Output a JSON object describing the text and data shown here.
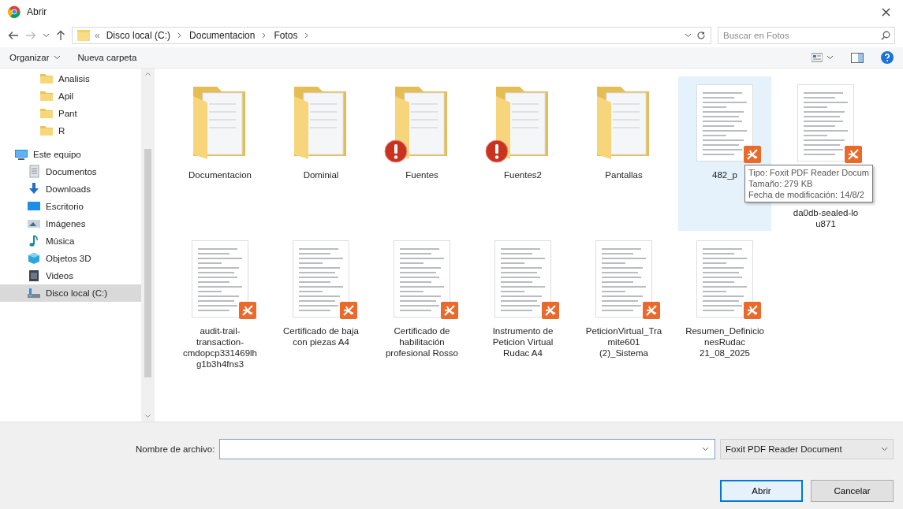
{
  "window": {
    "title": "Abrir"
  },
  "address_bar": {
    "overflow": "«",
    "path": [
      {
        "label": "Disco local (C:)"
      },
      {
        "label": "Documentacion"
      },
      {
        "label": "Fotos"
      }
    ],
    "search": {
      "placeholder": "Buscar en Fotos"
    }
  },
  "toolbar": {
    "organize": "Organizar",
    "new_folder": "Nueva carpeta"
  },
  "sidebar": {
    "items": [
      {
        "label": "Analisis",
        "kind": "folder",
        "selected": false
      },
      {
        "label": "Apil",
        "kind": "folder",
        "selected": false
      },
      {
        "label": "Pant",
        "kind": "folder",
        "selected": false
      },
      {
        "label": "R",
        "kind": "folder",
        "selected": false
      },
      {
        "label": "Este equipo",
        "kind": "pc",
        "selected": false,
        "children": [
          {
            "label": "Documentos",
            "kind": "documents",
            "selected": false
          },
          {
            "label": "Downloads",
            "kind": "downloads",
            "selected": false
          },
          {
            "label": "Escritorio",
            "kind": "desktop",
            "selected": false
          },
          {
            "label": "Imágenes",
            "kind": "pictures",
            "selected": false
          },
          {
            "label": "Música",
            "kind": "music",
            "selected": false
          },
          {
            "label": "Objetos 3D",
            "kind": "objects3d",
            "selected": false
          },
          {
            "label": "Videos",
            "kind": "videos",
            "selected": false
          },
          {
            "label": "Disco local (C:)",
            "kind": "drive",
            "selected": true
          }
        ]
      }
    ]
  },
  "files": [
    {
      "name": "Documentacion",
      "kind": "folder",
      "warning": false,
      "selected": false
    },
    {
      "name": "Dominial",
      "kind": "folder",
      "warning": false,
      "selected": false
    },
    {
      "name": "Fuentes",
      "kind": "folder",
      "warning": true,
      "selected": false
    },
    {
      "name": "Fuentes2",
      "kind": "folder",
      "warning": true,
      "selected": false
    },
    {
      "name": "Pantallas",
      "kind": "folder",
      "warning": false,
      "selected": false
    },
    {
      "name": "482_p",
      "kind": "pdf",
      "warning": false,
      "selected": true,
      "tooltip": [
        "Tipo: Foxit PDF Reader Docum",
        "Tamaño: 279 KB",
        "Fecha de modificación: 14/8/2"
      ]
    },
    {
      "name": "da0db-sealed-lo u871",
      "kind": "pdf",
      "warning": false,
      "selected": false
    },
    {
      "name": "audit-trail-transaction-cmdopcp331469lhg1b3h4fns3",
      "kind": "pdf",
      "warning": false,
      "selected": false
    },
    {
      "name": "Certificado de baja con piezas A4",
      "kind": "pdf",
      "warning": false,
      "selected": false
    },
    {
      "name": "Certificado de habilitación profesional Rosso",
      "kind": "pdf",
      "warning": false,
      "selected": false
    },
    {
      "name": "Instrumento de Peticion Virtual Rudac A4",
      "kind": "pdf",
      "warning": false,
      "selected": false
    },
    {
      "name": "PeticionVirtual_Tramite601 (2)_Sistema",
      "kind": "pdf",
      "warning": false,
      "selected": false
    },
    {
      "name": "Resumen_DefinicionesRudac 21_08_2025",
      "kind": "pdf",
      "warning": false,
      "selected": false
    }
  ],
  "footer": {
    "filename_label": "Nombre de archivo:",
    "filter": "Foxit PDF Reader Document",
    "buttons": [
      {
        "label": "Abrir",
        "default": true
      },
      {
        "label": "Cancelar",
        "default": false
      }
    ]
  }
}
